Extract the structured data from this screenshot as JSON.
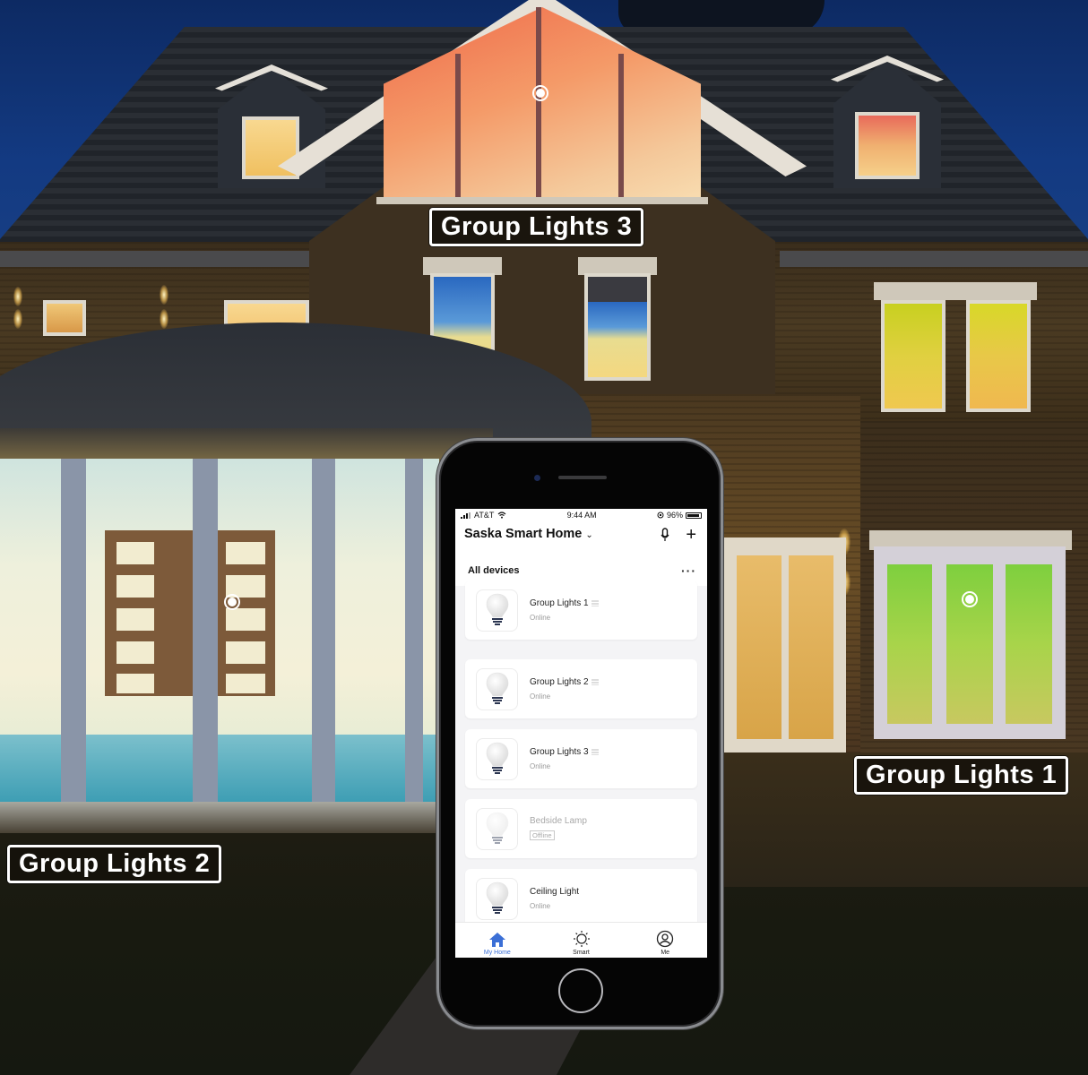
{
  "scene": {
    "description": "house-at-night",
    "labels": [
      {
        "id": "group-lights-3",
        "text": "Group Lights 3"
      },
      {
        "id": "group-lights-2",
        "text": "Group Lights 2"
      },
      {
        "id": "group-lights-1",
        "text": "Group Lights 1"
      }
    ],
    "light_colors": {
      "group_lights_3": "#f28a5e",
      "group_lights_2": "#eef0dc",
      "group_lights_1": "#8ed03e"
    }
  },
  "phone": {
    "status_bar": {
      "carrier": "AT&T",
      "time": "9:44 AM",
      "battery": "96%"
    },
    "header": {
      "home_name": "Saska Smart Home",
      "home_chevron": "⌄",
      "add_label": "+",
      "tab_label": "All devices",
      "more_label": "···"
    },
    "devices": [
      {
        "name": "Group Lights 1",
        "status": "Online",
        "online": true
      },
      {
        "name": "Group Lights 2",
        "status": "Online",
        "online": true
      },
      {
        "name": "Group Lights 3",
        "status": "Online",
        "online": true
      },
      {
        "name": "Bedside Lamp",
        "status": "Offline",
        "online": false
      },
      {
        "name": "Ceiling Light",
        "status": "Online",
        "online": true
      }
    ],
    "tab_bar": [
      {
        "label": "My Home",
        "icon": "home-icon",
        "active": true
      },
      {
        "label": "Smart",
        "icon": "sun-icon",
        "active": false
      },
      {
        "label": "Me",
        "icon": "profile-icon",
        "active": false
      }
    ],
    "accent_color": "#3b6fd6"
  }
}
